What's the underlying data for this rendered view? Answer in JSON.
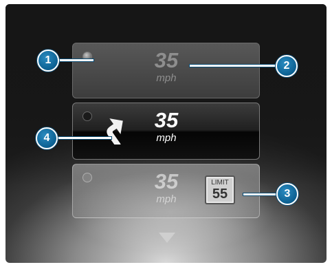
{
  "tiles": [
    {
      "speed": "35",
      "unit": "mph",
      "state": "inactive"
    },
    {
      "speed": "35",
      "unit": "mph",
      "state": "selected",
      "icon": "turn-right-arrow-icon"
    },
    {
      "speed": "35",
      "unit": "mph",
      "state": "faded",
      "limit_label": "LIMIT",
      "limit_value": "55"
    }
  ],
  "callouts": [
    "1",
    "2",
    "3",
    "4"
  ],
  "colors": {
    "callout_blue": "#0a5d8e",
    "background_dark": "#1c1c1c"
  }
}
